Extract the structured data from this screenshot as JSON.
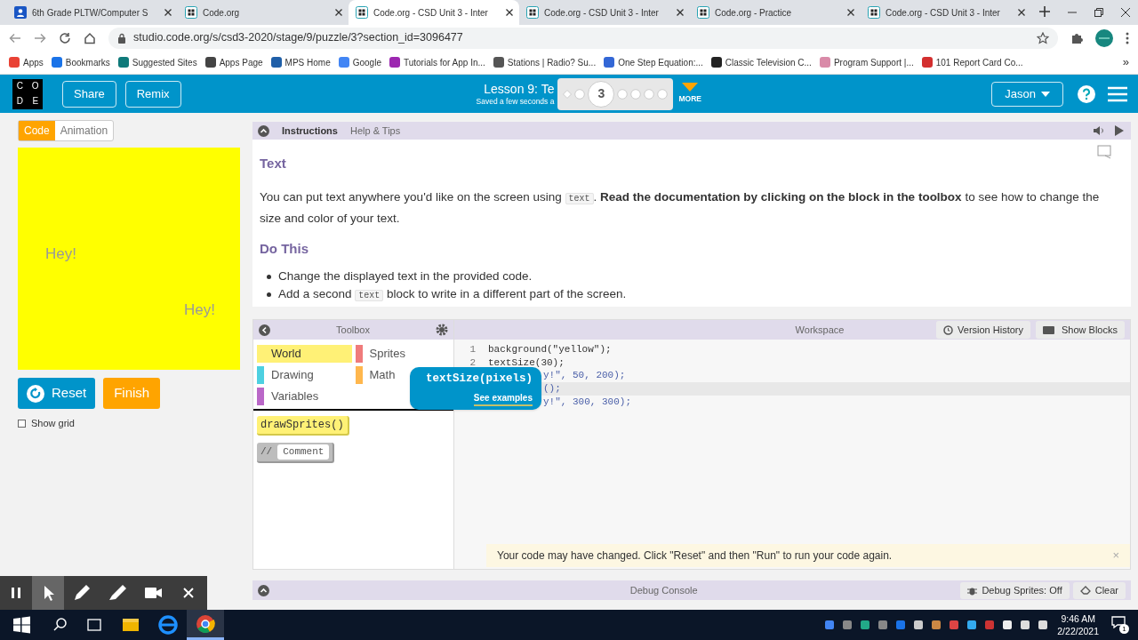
{
  "browser": {
    "tabs": [
      {
        "title": "6th Grade PLTW/Computer S",
        "selected": false,
        "kind": "person"
      },
      {
        "title": "Code.org",
        "selected": false,
        "kind": "code"
      },
      {
        "title": "Code.org - CSD Unit 3 - Inter",
        "selected": true,
        "kind": "code"
      },
      {
        "title": "Code.org - CSD Unit 3 - Inter",
        "selected": false,
        "kind": "code"
      },
      {
        "title": "Code.org - Practice",
        "selected": false,
        "kind": "code"
      },
      {
        "title": "Code.org - CSD Unit 3 - Inter",
        "selected": false,
        "kind": "code"
      }
    ],
    "address": "studio.code.org/s/csd3-2020/stage/9/puzzle/3?section_id=3096477",
    "bookmarks": [
      {
        "label": "Apps",
        "color": "#e94235"
      },
      {
        "label": "Bookmarks",
        "color": "#1a73e8"
      },
      {
        "label": "Suggested Sites",
        "color": "#0f7a7a"
      },
      {
        "label": "Apps Page",
        "color": "#444444"
      },
      {
        "label": "MPS Home",
        "color": "#1f5fa8"
      },
      {
        "label": "Google",
        "color": "#4285f4"
      },
      {
        "label": "Tutorials for App In...",
        "color": "#9c27b0"
      },
      {
        "label": "Stations | Radio? Su...",
        "color": "#555555"
      },
      {
        "label": "One Step Equation:...",
        "color": "#3367d6"
      },
      {
        "label": "Classic Television C...",
        "color": "#222222"
      },
      {
        "label": "Program Support |...",
        "color": "#d98aa8"
      },
      {
        "label": "101 Report Card Co...",
        "color": "#d32f2f"
      }
    ],
    "more": "»"
  },
  "header": {
    "logo": [
      "C",
      "O",
      "D",
      "E"
    ],
    "share": "Share",
    "remix": "Remix",
    "lesson": "Lesson 9: Te",
    "saved": "Saved a few seconds a",
    "progress": [
      {
        "kind": "diamond",
        "selected": false
      },
      {
        "kind": "dot",
        "selected": false
      },
      {
        "kind": "numbered",
        "label": "3",
        "selected": true
      },
      {
        "kind": "dot",
        "selected": false
      },
      {
        "kind": "dot",
        "selected": false
      },
      {
        "kind": "dot",
        "selected": false
      },
      {
        "kind": "dot",
        "selected": false
      }
    ],
    "more": "MORE",
    "user": "Jason"
  },
  "left": {
    "tabs": [
      {
        "label": "Code",
        "selected": true
      },
      {
        "label": "Animation",
        "selected": false
      }
    ],
    "canvas_texts": [
      "Hey!",
      "Hey!"
    ],
    "reset": "Reset",
    "finish": "Finish",
    "show_grid": {
      "label": "Show grid",
      "checked": false
    }
  },
  "instructions": {
    "tabs": [
      {
        "label": "Instructions",
        "selected": true
      },
      {
        "label": "Help & Tips",
        "selected": false
      }
    ],
    "heading": "Text",
    "paragraph": [
      {
        "kind": "text",
        "text": "You can put text anywhere you'd like on the screen using "
      },
      {
        "kind": "code",
        "text": "text"
      },
      {
        "kind": "text",
        "text": ". **Read the documentation by clicking on the block in the toolbox** to see how to change the size and color of your text."
      }
    ],
    "heading2": "Do This",
    "bullets": [
      [
        {
          "kind": "text",
          "text": "Change the displayed text in the provided code."
        }
      ],
      [
        {
          "kind": "text",
          "text": "Add a second "
        },
        {
          "kind": "code",
          "text": "text"
        },
        {
          "kind": "text",
          "text": " block to write in a different part of the screen."
        }
      ]
    ]
  },
  "toolbox": {
    "title": "Toolbox",
    "categories": [
      {
        "label": "World",
        "color": "#fff176",
        "selected": true
      },
      {
        "label": "Sprites",
        "color": "#ef7b7b",
        "selected": false
      },
      {
        "label": "Drawing",
        "color": "#4dd0e1",
        "selected": false
      },
      {
        "label": "Math",
        "color": "#ffb74d",
        "selected": false
      },
      {
        "label": "Variables",
        "color": "#ba68c8",
        "selected": false
      }
    ],
    "blocks": [
      {
        "kind": "function",
        "label": "drawSprites()"
      },
      {
        "kind": "comment",
        "label": "Comment",
        "prefix": "//"
      }
    ]
  },
  "workspace": {
    "title": "Workspace",
    "version_history": "Version History",
    "show_blocks": "Show Blocks",
    "lines": [
      {
        "kind": "full",
        "number": "1",
        "text": "background(\"yellow\");"
      },
      {
        "kind": "full",
        "number": "2",
        "text": "textSize(30);"
      },
      {
        "kind": "partial",
        "text": "y!\", 50, 200);"
      },
      {
        "kind": "partial",
        "text": "();",
        "current": true
      },
      {
        "kind": "partial",
        "text": "y!\", 300, 300);"
      }
    ],
    "tooltip": {
      "signature": "textSize(pixels)",
      "link": "See examples"
    },
    "notice": "Your code may have changed. Click \"Reset\" and then \"Run\" to run your code again.",
    "notice_close": "×"
  },
  "debug": {
    "title": "Debug Console",
    "sprites": "Debug Sprites: Off",
    "clear": "Clear"
  },
  "taskbar": {
    "time": "9:46 AM",
    "date": "2/22/2021",
    "notifications": "1"
  }
}
